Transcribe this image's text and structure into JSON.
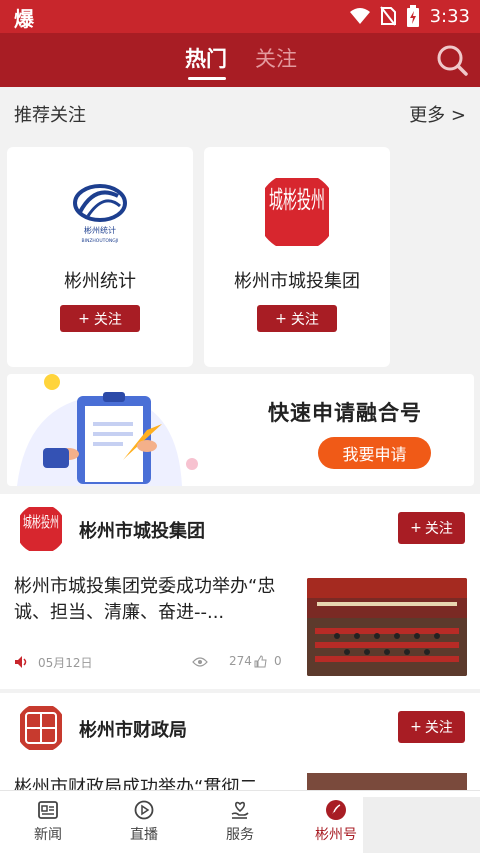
{
  "status_bar": {
    "app_glyph": "爆",
    "time": "3:33"
  },
  "header": {
    "tabs": [
      {
        "label": "热门",
        "active": true
      },
      {
        "label": "关注",
        "active": false
      }
    ],
    "search_icon": "search-icon"
  },
  "recommend": {
    "title": "推荐关注",
    "more": "更多 >",
    "cards": [
      {
        "name": "彬州统计",
        "follow_label": "关注",
        "logo_text": "彬州统计",
        "logo_subtext": "BINZHOUTONGJI"
      },
      {
        "name": "彬州市城投集团",
        "follow_label": "关注",
        "logo_text": "城彬投州"
      }
    ]
  },
  "banner": {
    "title": "快速申请融合号",
    "button_label": "我要申请"
  },
  "feed": [
    {
      "account": "彬州市城投集团",
      "follow_label": "关注",
      "text": "彬州市城投集团党委成功举办“忠诚、担当、清廉、奋进--...",
      "date": "05月12日",
      "views": "274",
      "likes": "0"
    },
    {
      "account": "彬州市财政局",
      "follow_label": "关注",
      "text": "彬州市财政局成功举办“贯彻二"
    }
  ],
  "bottom_nav": [
    {
      "label": "新闻",
      "icon": "news-icon"
    },
    {
      "label": "直播",
      "icon": "live-icon"
    },
    {
      "label": "服务",
      "icon": "service-icon"
    },
    {
      "label": "彬州号",
      "icon": "chenzhou-icon",
      "active": true
    }
  ],
  "colors": {
    "brand_red": "#a81d24",
    "status_red": "#c8262c",
    "apply_orange": "#f05a17"
  }
}
